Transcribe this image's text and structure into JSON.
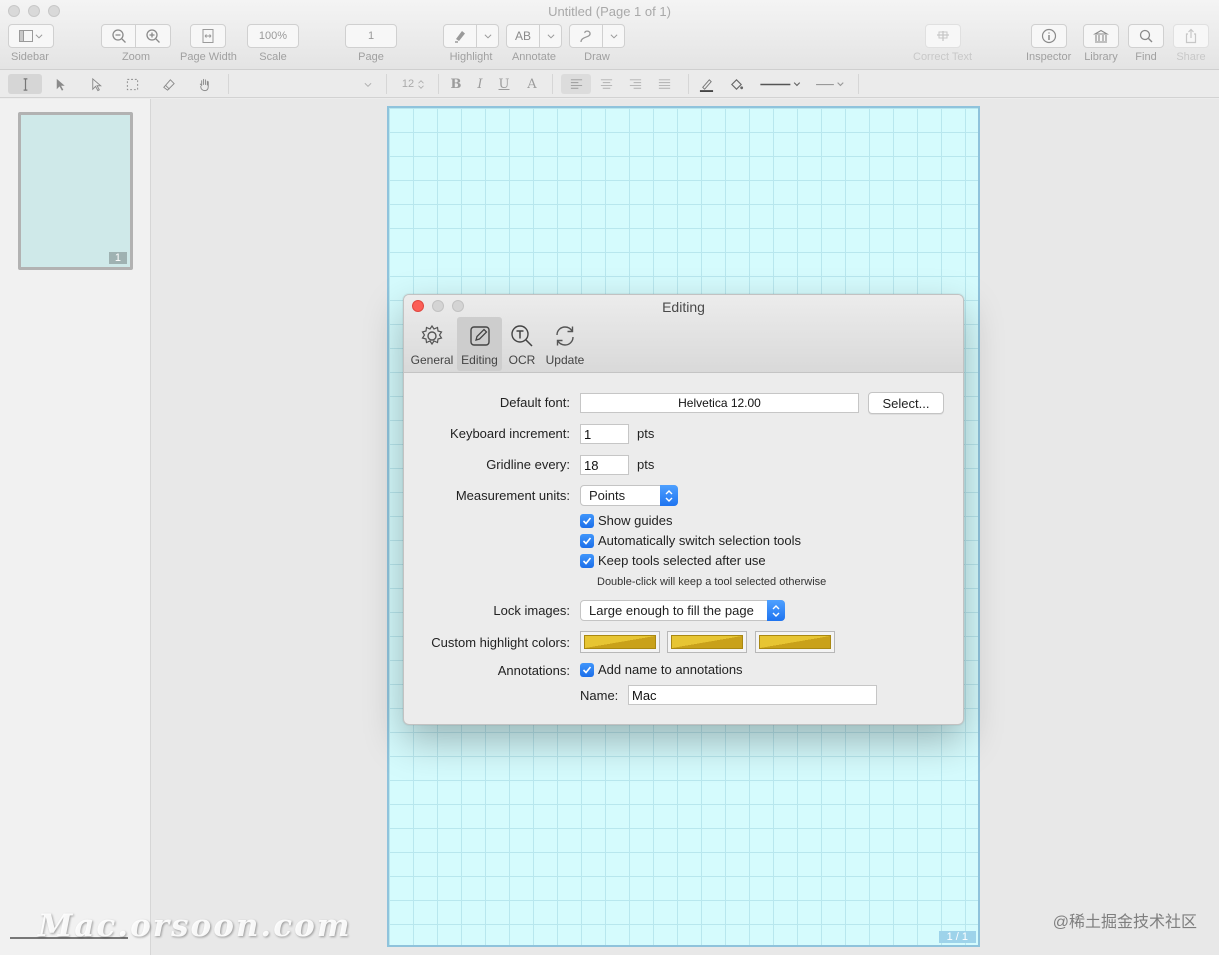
{
  "window": {
    "title": "Untitled (Page 1 of 1)"
  },
  "toolbar": {
    "sidebar_label": "Sidebar",
    "zoom_label": "Zoom",
    "page_width_label": "Page Width",
    "scale_label": "Scale",
    "scale_value": "100%",
    "page_label": "Page",
    "page_value": "1",
    "highlight_label": "Highlight",
    "annotate_label": "Annotate",
    "annotate_glyph": "AB",
    "draw_label": "Draw",
    "correct_text_label": "Correct Text",
    "inspector_label": "Inspector",
    "library_label": "Library",
    "find_label": "Find",
    "share_label": "Share"
  },
  "format_bar": {
    "font_size": "12",
    "bold": "B",
    "italic": "I",
    "underline": "U",
    "text_color": "A"
  },
  "sidebar": {
    "thumb_page_number": "1"
  },
  "canvas": {
    "page_indicator": "1 / 1"
  },
  "dialog": {
    "title": "Editing",
    "tabs": [
      {
        "label": "General",
        "icon": "gear-icon"
      },
      {
        "label": "Editing",
        "icon": "pencil-square-icon"
      },
      {
        "label": "OCR",
        "icon": "ocr-magnifier-icon"
      },
      {
        "label": "Update",
        "icon": "refresh-icon"
      }
    ],
    "default_font_label": "Default font:",
    "default_font_value": "Helvetica 12.00",
    "select_button": "Select...",
    "keyboard_increment_label": "Keyboard increment:",
    "keyboard_increment_value": "1",
    "gridline_label": "Gridline every:",
    "gridline_value": "18",
    "pts": "pts",
    "measurement_units_label": "Measurement units:",
    "measurement_units_value": "Points",
    "show_guides": "Show guides",
    "auto_switch": "Automatically switch selection tools",
    "keep_tools": "Keep tools selected after use",
    "keep_tools_hint": "Double-click will keep a tool selected otherwise",
    "lock_images_label": "Lock images:",
    "lock_images_value": "Large enough to fill the page",
    "custom_highlight_label": "Custom highlight colors:",
    "highlight_colors": [
      "#e7c533",
      "#e7c533",
      "#e7c533"
    ],
    "annotations_label": "Annotations:",
    "add_name": "Add name to annotations",
    "name_label": "Name:",
    "name_value": "Mac"
  },
  "watermark": {
    "left": "Mac.orsoon.com",
    "right": "@稀土掘金技术社区"
  }
}
